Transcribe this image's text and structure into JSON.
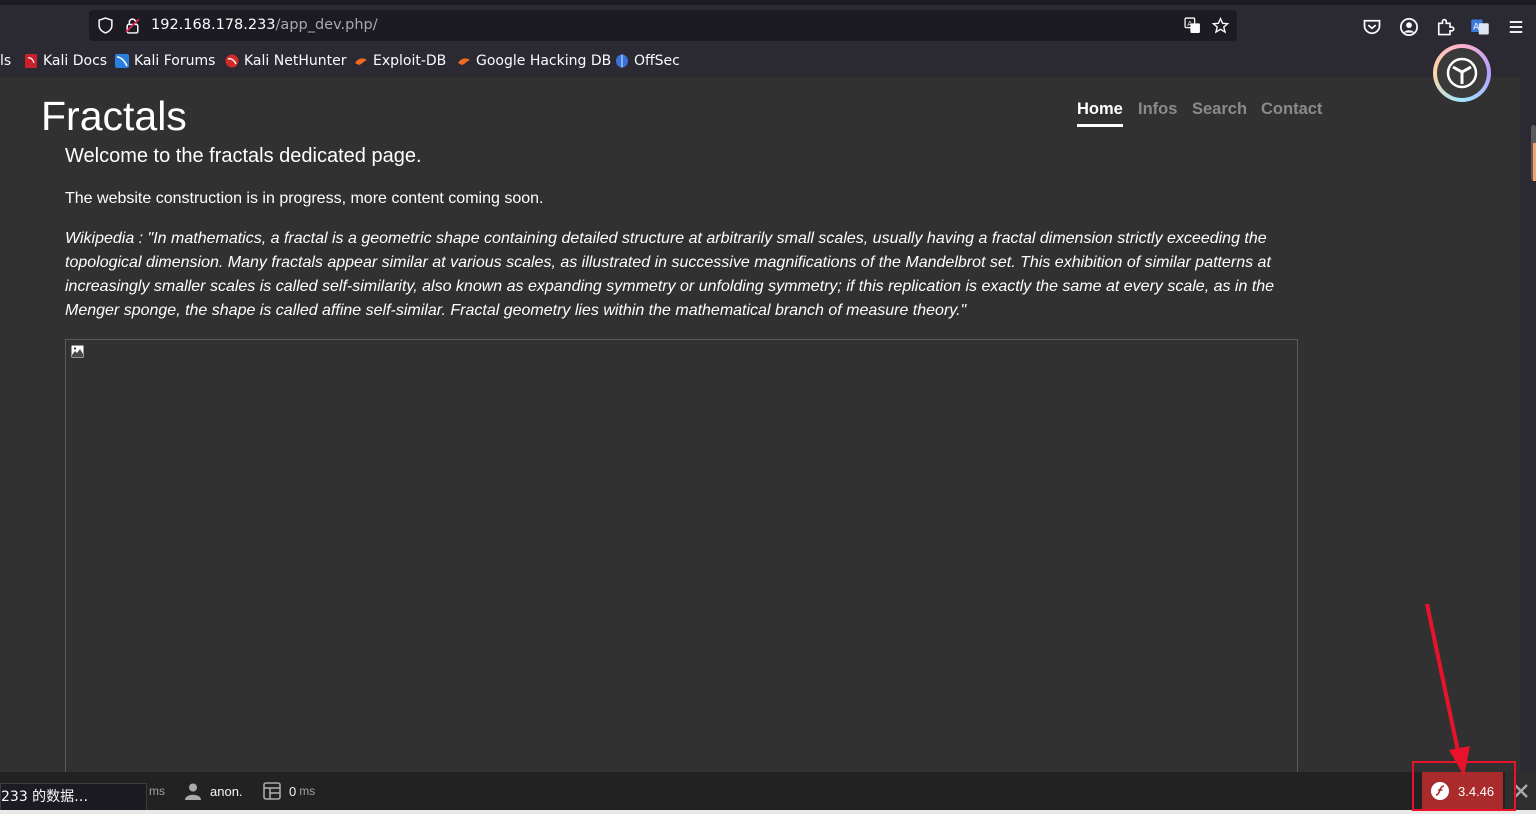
{
  "browser": {
    "url_host": "192.168.178.233",
    "url_path": "/app_dev.php/",
    "bookmarks": [
      {
        "label": "ls",
        "icon": "none"
      },
      {
        "label": "Kali Docs",
        "icon": "kali-docs-icon"
      },
      {
        "label": "Kali Forums",
        "icon": "kali-forums-icon"
      },
      {
        "label": "Kali NetHunter",
        "icon": "kali-nethunter-icon"
      },
      {
        "label": "Exploit-DB",
        "icon": "exploit-db-icon"
      },
      {
        "label": "Google Hacking DB",
        "icon": "ghdb-icon"
      },
      {
        "label": "OffSec",
        "icon": "offsec-icon"
      }
    ]
  },
  "site": {
    "title": "Fractals",
    "nav": [
      {
        "label": "Home",
        "active": true
      },
      {
        "label": "Infos",
        "active": false
      },
      {
        "label": "Search",
        "active": false
      },
      {
        "label": "Contact",
        "active": false
      }
    ],
    "heading": "Welcome to the fractals dedicated page.",
    "intro": "The website construction is in progress, more content coming soon.",
    "quote": "Wikipedia : \"In mathematics, a fractal is a geometric shape containing detailed structure at arbitrarily small scales, usually having a fractal dimension strictly exceeding the topological dimension. Many fractals appear similar at various scales, as illustrated in successive magnifications of the Mandelbrot set. This exhibition of similar patterns at increasingly smaller scales is called self-similarity, also known as expanding symmetry or unfolding symmetry; if this replication is exactly the same at every scale, as in the Menger sponge, the shape is called affine self-similar. Fractal geometry lies within the mathematical branch of measure theory.\""
  },
  "debug_toolbar": {
    "time_unit": "ms",
    "user": "anon.",
    "db_value": "0",
    "db_unit": "ms",
    "version": "3.4.46"
  },
  "status_text": "233 的数据…",
  "colors": {
    "toolbar_bg": "#222222",
    "version_bg": "#aa2b2b",
    "annotation": "#e8132b"
  }
}
